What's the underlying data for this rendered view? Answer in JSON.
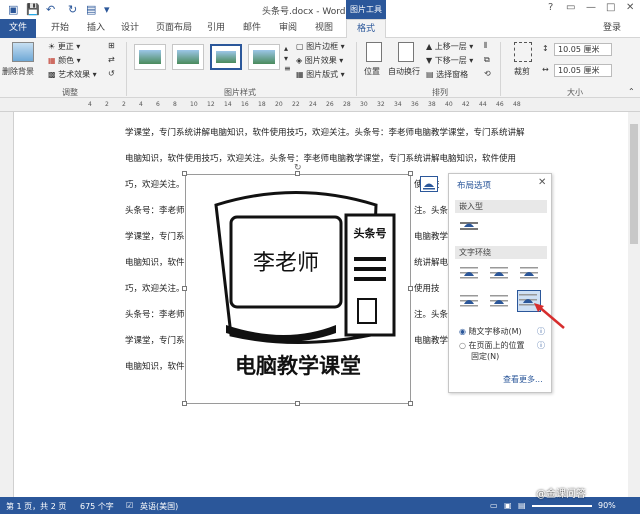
{
  "titlebar": {
    "doc_title": "头条号.docx - Word",
    "context_title": "图片工具",
    "help": "?",
    "restore": "▭",
    "minimize": "—",
    "maximize": "□",
    "close": "✕"
  },
  "tabs": [
    "文件",
    "开始",
    "插入",
    "设计",
    "页面布局",
    "引用",
    "邮件",
    "审阅",
    "视图",
    "格式"
  ],
  "login": "登录",
  "ribbon": {
    "remove_bg": "删除背景",
    "correct": "更正",
    "color": "颜色",
    "art": "艺术效果",
    "adjust": "调整",
    "pic_styles": "图片样式",
    "border": "图片边框",
    "effect": "图片效果",
    "layout": "图片版式",
    "position": "位置",
    "autowrap": "自动换行",
    "forward": "上移一层",
    "backward": "下移一层",
    "pane": "选择窗格",
    "arrange": "排列",
    "crop": "裁剪",
    "height": "10.05 厘米",
    "width": "10.05 厘米",
    "size": "大小"
  },
  "ruler_nums": [
    "4",
    "2",
    "2",
    "4",
    "6",
    "8",
    "10",
    "12",
    "14",
    "16",
    "18",
    "20",
    "22",
    "24",
    "26",
    "28",
    "30",
    "32",
    "34",
    "36",
    "38",
    "40",
    "42",
    "44",
    "46",
    "48"
  ],
  "doc": {
    "lines": [
      "学课堂，专门系统讲解电脑知识，软件使用技巧，欢迎关注。头条号：李老师电脑教学课堂，专门系统讲解",
      "电脑知识，软件使用技巧，欢迎关注。头条号：李老师电脑教学课堂，专门系统讲解电脑知识，软件使用",
      "巧，欢迎关注。",
      "头条号：李老师",
      "学课堂，专门系",
      "电脑知识，软件",
      "巧，欢迎关注。",
      "头条号：李老师",
      "学课堂，专门系",
      "电脑知识，软件"
    ],
    "right_frags": [
      "使用技",
      "注。头条",
      "电脑教学课",
      "统讲解电",
      "使用技",
      "注。头条",
      "电脑教学课"
    ],
    "pic_text": "电脑教学课堂",
    "screen_text": "李老师",
    "box_text": "头条号"
  },
  "panel": {
    "title": "布局选项",
    "inline": "嵌入型",
    "wrap": "文字环绕",
    "move": "随文字移动(M)",
    "fixed": "在页面上的位置",
    "fixed2": "固定(N)",
    "more": "查看更多..."
  },
  "status": {
    "page": "第 1 页，共 2 页",
    "words": "675 个字",
    "lang": "英语(美国)",
    "zoom": "90%",
    "watermark": "@金课问答"
  }
}
